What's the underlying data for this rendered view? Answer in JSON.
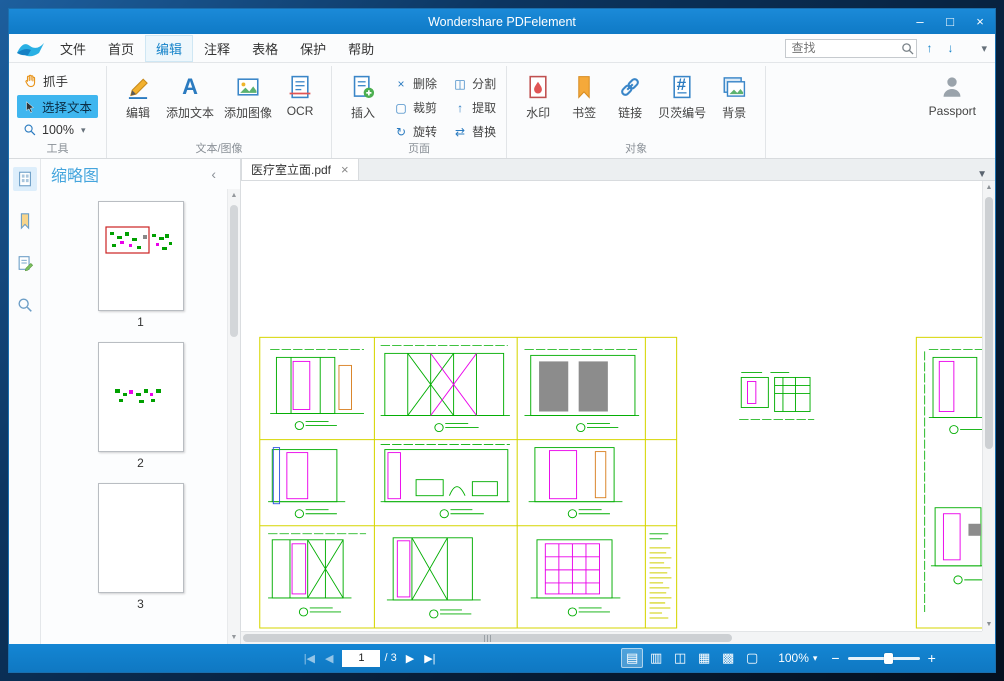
{
  "window": {
    "title": "Wondershare PDFelement",
    "minimize_glyph": "–",
    "maximize_glyph": "□",
    "close_glyph": "×"
  },
  "menubar": {
    "tabs": [
      {
        "label": "文件"
      },
      {
        "label": "首页"
      },
      {
        "label": "编辑"
      },
      {
        "label": "注释"
      },
      {
        "label": "表格"
      },
      {
        "label": "保护"
      },
      {
        "label": "帮助"
      }
    ],
    "search_placeholder": "查找",
    "search_prev_glyph": "↑",
    "search_next_glyph": "↓",
    "ribbon_collapse_glyph": "▾"
  },
  "ribbon": {
    "hand_label": "抓手",
    "select_text_label": "选择文本",
    "zoom_value": "100%",
    "zoom_caret": "▾",
    "edit_label": "编辑",
    "add_text_label": "添加文本",
    "add_text_glyph": "A",
    "add_image_label": "添加图像",
    "ocr_label": "OCR",
    "insert_label": "插入",
    "ops": [
      {
        "glyph": "×",
        "label": "删除"
      },
      {
        "glyph": "◫",
        "label": "分割"
      },
      {
        "glyph": "▢",
        "label": "裁剪"
      },
      {
        "glyph": "↑",
        "label": "提取"
      },
      {
        "glyph": "↻",
        "label": "旋转"
      },
      {
        "glyph": "⇄",
        "label": "替换"
      }
    ],
    "watermark_label": "水印",
    "bookmark_label": "书签",
    "link_label": "链接",
    "bates_label": "贝茨编号",
    "bates_glyph": "#",
    "background_label": "背景",
    "passport_label": "Passport",
    "groups": {
      "tools": "工具",
      "text_image": "文本/图像",
      "page": "页面",
      "object": "对象"
    }
  },
  "sidebar": {
    "title": "缩略图",
    "collapse_glyph": "‹",
    "pages": [
      {
        "number": "1"
      },
      {
        "number": "2"
      },
      {
        "number": "3"
      }
    ]
  },
  "document": {
    "tab_title": "医疗室立面.pdf",
    "tab_close_glyph": "×",
    "tab_list_glyph": "▼"
  },
  "statusbar": {
    "first_glyph": "|◀",
    "prev_glyph": "◀",
    "page_value": "1",
    "page_total": "/ 3",
    "next_glyph": "▶",
    "last_glyph": "▶|",
    "views": [
      {
        "glyph": "▤"
      },
      {
        "glyph": "▥"
      },
      {
        "glyph": "◫"
      },
      {
        "glyph": "▦"
      },
      {
        "glyph": "▩"
      },
      {
        "glyph": "▢"
      }
    ],
    "zoom_value": "100%",
    "zoom_caret": "▾",
    "zoom_out_glyph": "−",
    "zoom_in_glyph": "+"
  }
}
